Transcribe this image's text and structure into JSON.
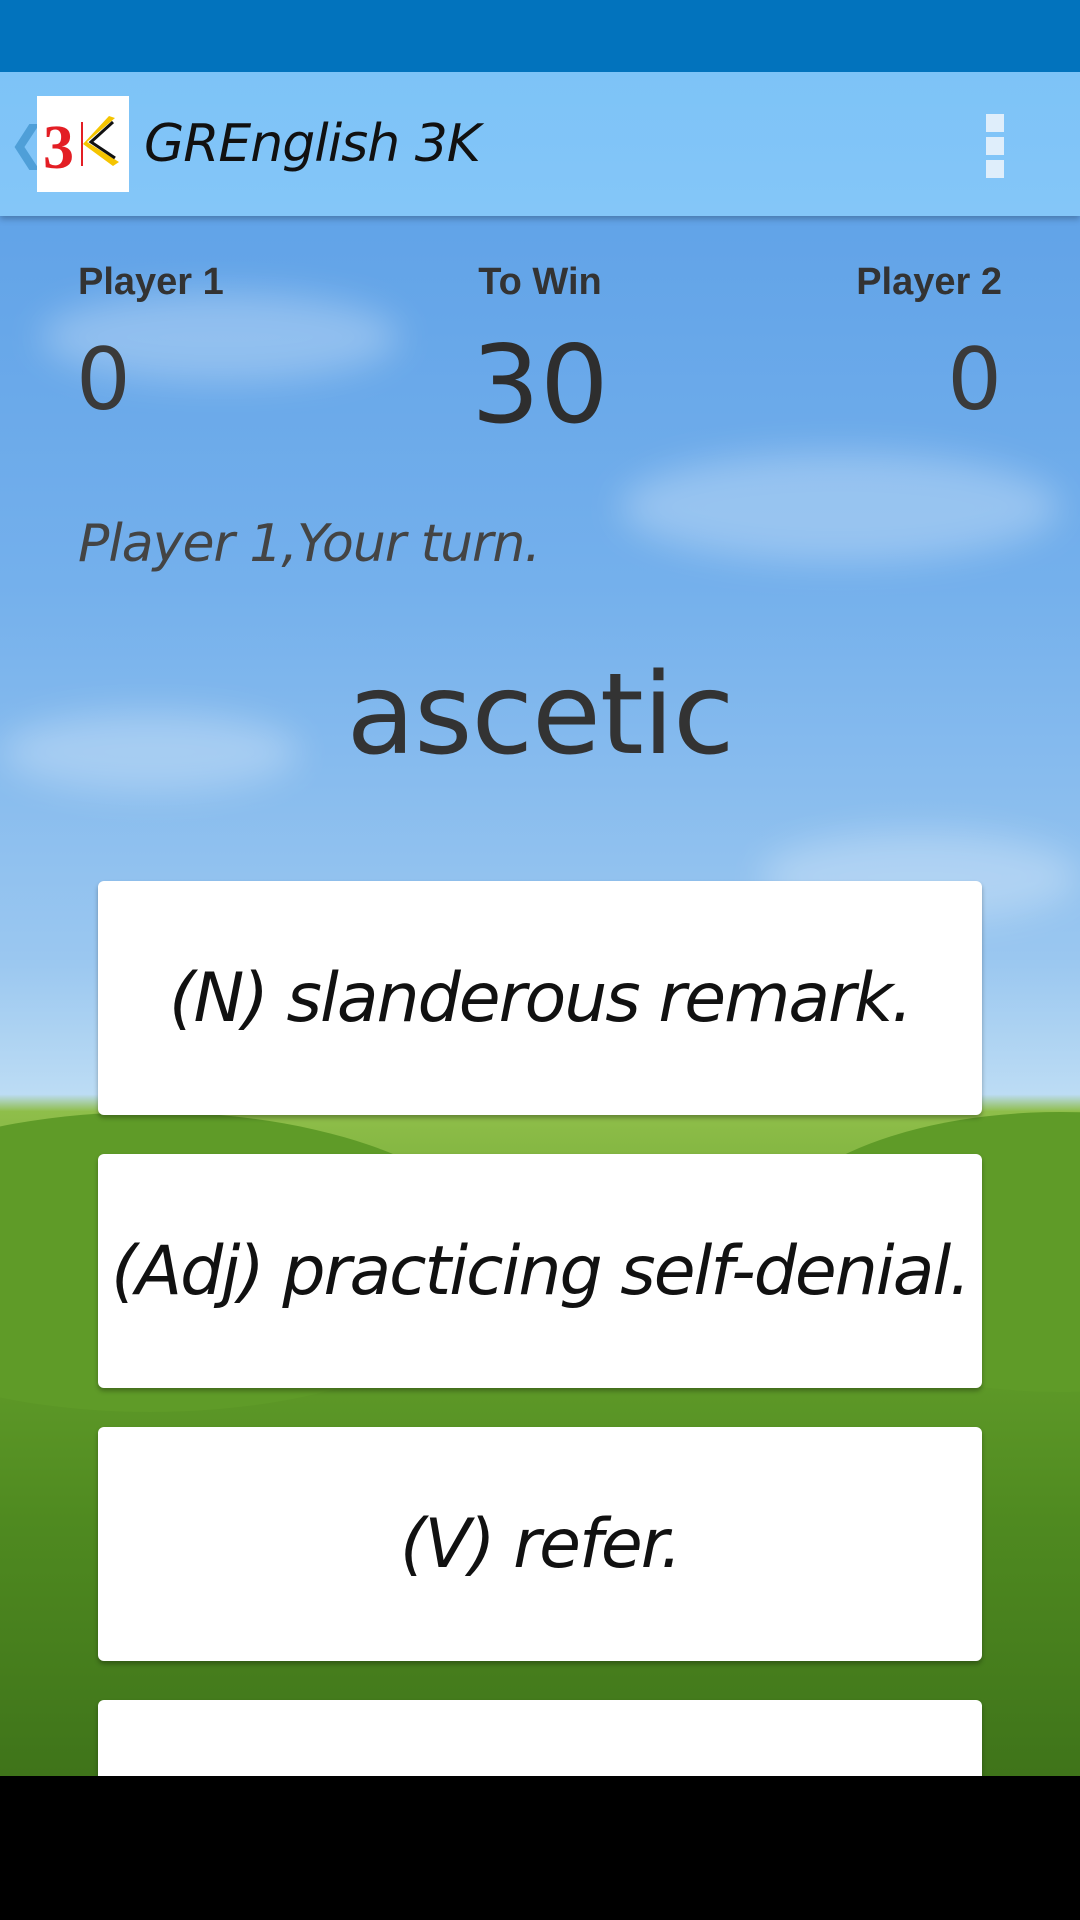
{
  "app": {
    "title": "GREnglish 3K",
    "logo_text": "3K",
    "back_icon": "chevron-left-icon",
    "menu_icon": "overflow-menu-icon"
  },
  "colors": {
    "status_bar": "#0273bd",
    "app_bar": "#84c6f8",
    "logo_red": "#e31e24",
    "logo_yellow": "#f5c400"
  },
  "scoreboard": {
    "player1_label": "Player 1",
    "player1_score": "0",
    "to_win_label": "To Win",
    "to_win_value": "30",
    "player2_label": "Player 2",
    "player2_score": "0"
  },
  "turn_message": "Player 1,Your turn.",
  "word": "ascetic",
  "options": [
    {
      "label": "(N) slanderous remark."
    },
    {
      "label": "(Adj) practicing self-denial."
    },
    {
      "label": "(V) refer."
    },
    {
      "label": ""
    }
  ]
}
